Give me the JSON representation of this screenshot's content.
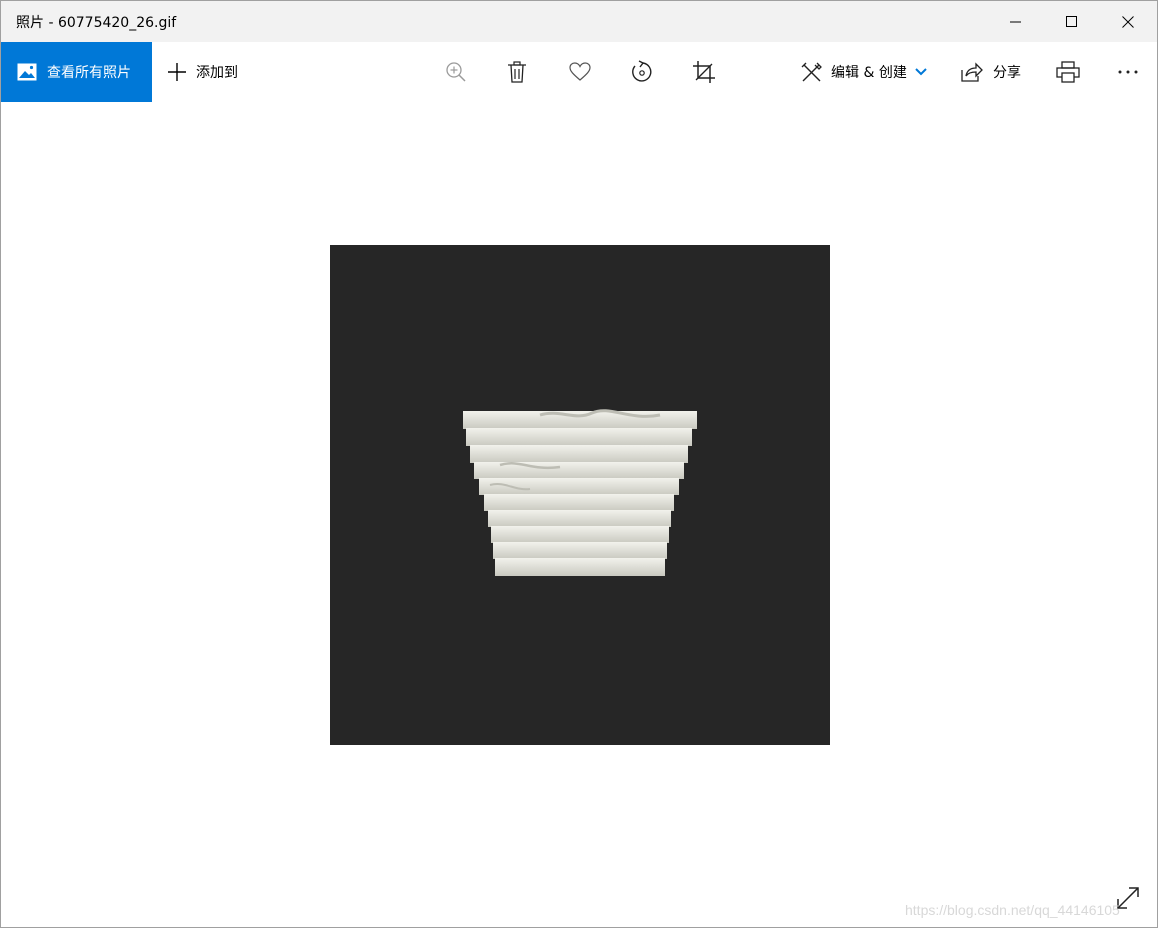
{
  "window": {
    "title": "照片 - 60775420_26.gif",
    "controls": [
      "minimize-icon",
      "maximize-icon",
      "close-icon"
    ]
  },
  "toolbar": {
    "view_all_label": "查看所有照片",
    "add_to_label": "添加到",
    "edit_create_label": "编辑 & 创建",
    "share_label": "分享",
    "icons": [
      "zoom-in-icon",
      "delete-icon",
      "favorite-icon",
      "rotate-icon",
      "crop-icon",
      "edit-icon",
      "share-icon",
      "print-icon",
      "more-icon"
    ]
  },
  "viewer": {
    "image_description_icon": "photo-icon",
    "watermark": "https://blog.csdn.net/qq_44146105"
  },
  "colors": {
    "accent": "#0078d7",
    "titlebar": "#f2f2f2",
    "photo_background": "#262626",
    "object": "#e6e6df"
  }
}
